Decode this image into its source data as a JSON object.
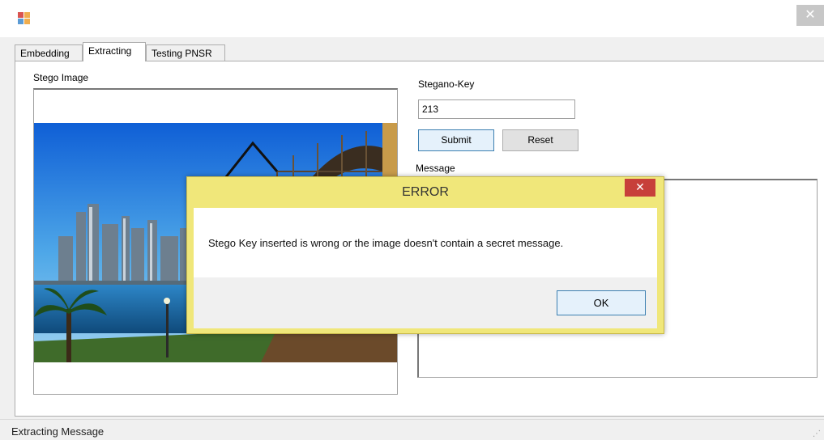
{
  "window": {
    "icon": "app-icon",
    "close_glyph": "✕"
  },
  "tabs": [
    {
      "label": "Embedding"
    },
    {
      "label": "Extracting"
    },
    {
      "label": "Testing PNSR"
    }
  ],
  "extracting": {
    "stego_image_label": "Stego Image",
    "stego_key_label": "Steganо-Key",
    "stego_key_value": "213",
    "submit_label": "Submit",
    "reset_label": "Reset",
    "message_label": "Message"
  },
  "dialog": {
    "title": "ERROR",
    "close_glyph": "✕",
    "message": "Stego Key inserted is wrong or the image doesn't contain a secret message.",
    "ok_label": "OK"
  },
  "statusbar": {
    "text": "Extracting Message",
    "grip": "⋰"
  },
  "colors": {
    "dialog_frame": "#f0e77a",
    "close_red": "#c7403a",
    "accent_blue": "#3c7fb1"
  }
}
